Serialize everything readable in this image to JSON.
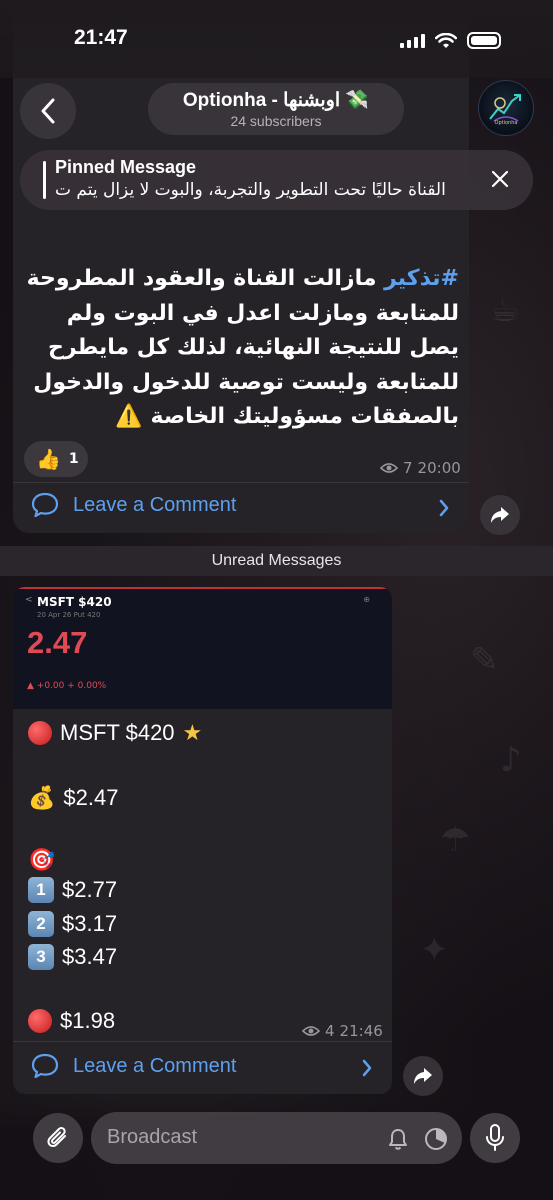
{
  "status_bar": {
    "time": "21:47"
  },
  "header": {
    "back_icon": "chevron-left-icon",
    "channel_title": "Optionha - اوبشنها 💸",
    "subscribers": "24 subscribers",
    "avatar_caption": "Optionha"
  },
  "pinned": {
    "title": "Pinned Message",
    "text": "القناة حاليًا تحت التطوير والتجربة، والبوت لا يزال يتم ت",
    "close_icon": "close-icon"
  },
  "message1": {
    "hashtag": "#تذكير",
    "text": " مازالت القناة والعقود المطروحة للمتابعة ومازلت اعدل في البوت ولم يصل للنتيجة النهائية، لذلك كل مايطرح للمتابعة وليست توصية للدخول والدخول بالصفقات مسؤوليتك الخاصة ⚠️",
    "reaction_emoji": "👍",
    "reaction_count": "1",
    "views": "7",
    "time": "20:00",
    "comment_label": "Leave a Comment"
  },
  "unread_label": "Unread Messages",
  "message2": {
    "screenshot": {
      "ticker": "MSFT $420",
      "subtitle": "20 Apr 26 Put 420",
      "price": "2.47",
      "change": "▲ +0.00 + 0.00%"
    },
    "ticker_line": "MSFT $420",
    "entry": "$2.47",
    "targets": [
      {
        "key": "1",
        "value": "$2.77"
      },
      {
        "key": "2",
        "value": "$3.17"
      },
      {
        "key": "3",
        "value": "$3.47"
      }
    ],
    "stop": "$1.98",
    "views": "4",
    "time": "21:46",
    "comment_label": "Leave a Comment"
  },
  "composer": {
    "placeholder": "Broadcast"
  },
  "colors": {
    "accent_blue": "#5ea0ee",
    "price_red": "#e04a55",
    "bubble": "#252228"
  }
}
